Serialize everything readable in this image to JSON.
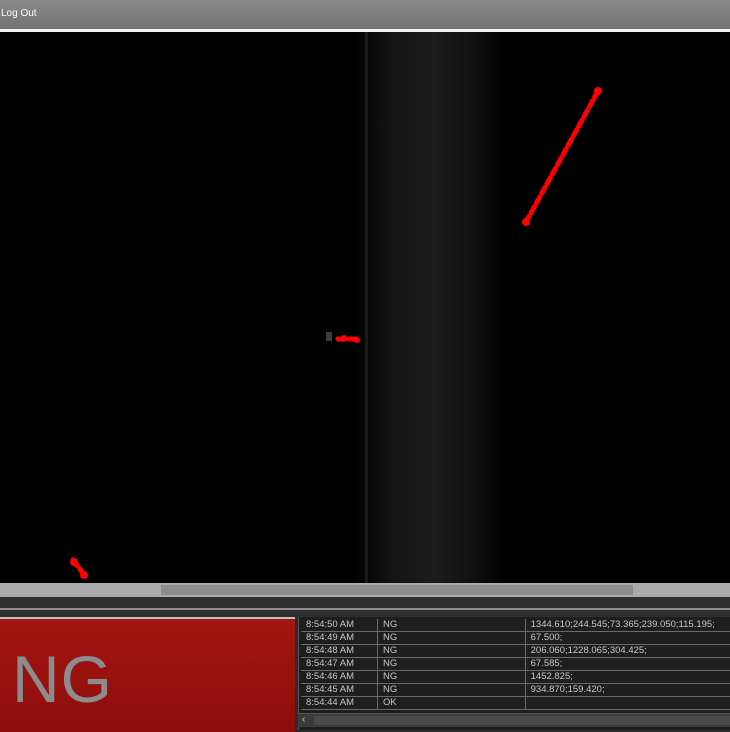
{
  "header": {
    "logout_label": "Log Out"
  },
  "result": {
    "status": "NG",
    "color": "#9c100d"
  },
  "log": {
    "rows": [
      {
        "time": "8:54:50 AM",
        "result": "NG",
        "values": "1344.610;244.545;73.365;239.050;115.195;"
      },
      {
        "time": "8:54:49 AM",
        "result": "NG",
        "values": "67.500;"
      },
      {
        "time": "8:54:48 AM",
        "result": "NG",
        "values": "206.060;1228.065;304.425;"
      },
      {
        "time": "8:54:47 AM",
        "result": "NG",
        "values": "67.585;"
      },
      {
        "time": "8:54:46 AM",
        "result": "NG",
        "values": "1452.825;"
      },
      {
        "time": "8:54:45 AM",
        "result": "NG",
        "values": "934.870;159.420;"
      },
      {
        "time": "8:54:44 AM",
        "result": "OK",
        "values": ""
      }
    ]
  },
  "icons": {
    "scroll_left": "chevron-left-icon"
  },
  "colors": {
    "defect_highlight": "#ff0000",
    "ng_background": "#9c100d"
  }
}
